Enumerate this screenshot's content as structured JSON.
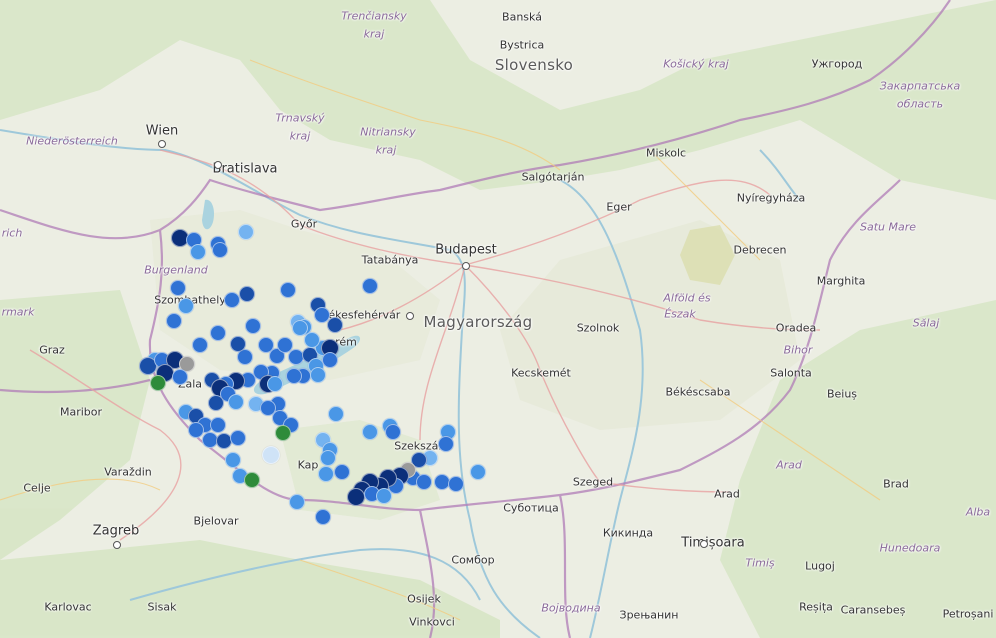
{
  "map": {
    "labels": [
      {
        "id": "slovensko",
        "text": "Slovensko",
        "type": "country"
      },
      {
        "id": "magyarorszag",
        "text": "Magyarország",
        "type": "country"
      },
      {
        "id": "trencin",
        "text": "Trenčiansky",
        "type": "region"
      },
      {
        "id": "trencin2",
        "text": "kraj",
        "type": "region"
      },
      {
        "id": "trnava",
        "text": "Trnavský",
        "type": "region"
      },
      {
        "id": "trnava2",
        "text": "kraj",
        "type": "region"
      },
      {
        "id": "nitra",
        "text": "Nitriansky",
        "type": "region"
      },
      {
        "id": "nitra2",
        "text": "kraj",
        "type": "region"
      },
      {
        "id": "kosice",
        "text": "Košický kraj",
        "type": "region"
      },
      {
        "id": "zakarp",
        "text": "Закарпатська",
        "type": "region"
      },
      {
        "id": "zakarp2",
        "text": "область",
        "type": "region"
      },
      {
        "id": "noe",
        "text": "Niederösterreich",
        "type": "region"
      },
      {
        "id": "burgenland",
        "text": "Burgenland",
        "type": "region"
      },
      {
        "id": "mark",
        "text": "rmark",
        "type": "region"
      },
      {
        "id": "rich",
        "text": "rich",
        "type": "region"
      },
      {
        "id": "alfold",
        "text": "Alföld és",
        "type": "region"
      },
      {
        "id": "alfold2",
        "text": "Észak",
        "type": "region"
      },
      {
        "id": "satumare",
        "text": "Satu Mare",
        "type": "region"
      },
      {
        "id": "salaj",
        "text": "Sălaj",
        "type": "region"
      },
      {
        "id": "bihor",
        "text": "Bihor",
        "type": "region"
      },
      {
        "id": "arad_r",
        "text": "Arad",
        "type": "region"
      },
      {
        "id": "alba",
        "text": "Alba",
        "type": "region"
      },
      {
        "id": "hunedoara",
        "text": "Hunedoara",
        "type": "region"
      },
      {
        "id": "timis",
        "text": "Timiș",
        "type": "region"
      },
      {
        "id": "vojvodina",
        "text": "Војводина",
        "type": "region"
      },
      {
        "id": "wien",
        "text": "Wien",
        "type": "capital"
      },
      {
        "id": "bratislava",
        "text": "Bratislava",
        "type": "capital"
      },
      {
        "id": "budapest",
        "text": "Budapest",
        "type": "capital"
      },
      {
        "id": "banska",
        "text": "Banská",
        "type": "city"
      },
      {
        "id": "banska2",
        "text": "Bystrica",
        "type": "city"
      },
      {
        "id": "uzhorod",
        "text": "Ужгород",
        "type": "city"
      },
      {
        "id": "miskolc",
        "text": "Miskolc",
        "type": "city"
      },
      {
        "id": "salgo",
        "text": "Salgótarján",
        "type": "city"
      },
      {
        "id": "eger",
        "text": "Eger",
        "type": "city"
      },
      {
        "id": "nyireg",
        "text": "Nyíregyháza",
        "type": "city"
      },
      {
        "id": "debrecen",
        "text": "Debrecen",
        "type": "city"
      },
      {
        "id": "gyor",
        "text": "Győr",
        "type": "city"
      },
      {
        "id": "tatabanya",
        "text": "Tatabánya",
        "type": "city"
      },
      {
        "id": "szfv",
        "text": "Székesfehérvár",
        "type": "city"
      },
      {
        "id": "szombathely",
        "text": "Szombathely",
        "type": "city"
      },
      {
        "id": "graz",
        "text": "Graz",
        "type": "city"
      },
      {
        "id": "maribor",
        "text": "Maribor",
        "type": "city"
      },
      {
        "id": "celje",
        "text": "Celje",
        "type": "city"
      },
      {
        "id": "varazdin",
        "text": "Varaždin",
        "type": "city"
      },
      {
        "id": "zagreb",
        "text": "Zagreb",
        "type": "capital"
      },
      {
        "id": "bjelovar",
        "text": "Bjelovar",
        "type": "city"
      },
      {
        "id": "karlovac",
        "text": "Karlovac",
        "type": "city"
      },
      {
        "id": "sisak",
        "text": "Sisak",
        "type": "city"
      },
      {
        "id": "osijek",
        "text": "Osijek",
        "type": "city"
      },
      {
        "id": "vinkovci",
        "text": "Vinkovci",
        "type": "city"
      },
      {
        "id": "sombor",
        "text": "Сомбор",
        "type": "city"
      },
      {
        "id": "subotica",
        "text": "Суботица",
        "type": "city"
      },
      {
        "id": "kikinda",
        "text": "Кикинда",
        "type": "city"
      },
      {
        "id": "zrenjanin",
        "text": "Зрењанин",
        "type": "city"
      },
      {
        "id": "szeged",
        "text": "Szeged",
        "type": "city"
      },
      {
        "id": "kecskemet",
        "text": "Kecskemét",
        "type": "city"
      },
      {
        "id": "szolnok",
        "text": "Szolnok",
        "type": "city"
      },
      {
        "id": "bekescsaba",
        "text": "Békéscsaba",
        "type": "city"
      },
      {
        "id": "oradea",
        "text": "Oradea",
        "type": "city"
      },
      {
        "id": "salonta",
        "text": "Salonta",
        "type": "city"
      },
      {
        "id": "beius",
        "text": "Beiuș",
        "type": "city"
      },
      {
        "id": "marghita",
        "text": "Marghita",
        "type": "city"
      },
      {
        "id": "arad",
        "text": "Arad",
        "type": "city"
      },
      {
        "id": "brad",
        "text": "Brad",
        "type": "city"
      },
      {
        "id": "timisoara",
        "text": "Timișoara",
        "type": "capital"
      },
      {
        "id": "lugoj",
        "text": "Lugoj",
        "type": "city"
      },
      {
        "id": "resita",
        "text": "Reșița",
        "type": "city"
      },
      {
        "id": "caransebes",
        "text": "Caransebeș",
        "type": "city"
      },
      {
        "id": "petrosani",
        "text": "Petroșani",
        "type": "city"
      },
      {
        "id": "szekszard",
        "text": "Szekszárd",
        "type": "city"
      },
      {
        "id": "kaposvar",
        "text": "Kap",
        "type": "city"
      },
      {
        "id": "zala",
        "text": "Zala",
        "type": "city"
      },
      {
        "id": "veszprem",
        "text": "rém",
        "type": "city"
      }
    ],
    "marker_colors": {
      "navy": "#0b2f7a",
      "dark": "#1a4fa8",
      "mid": "#2f72d4",
      "light": "#4a97e6",
      "pale": "#74b3f0",
      "faint": "#cfe3f7",
      "green": "#2e8b3a",
      "gray": "#9a9a9a"
    }
  }
}
